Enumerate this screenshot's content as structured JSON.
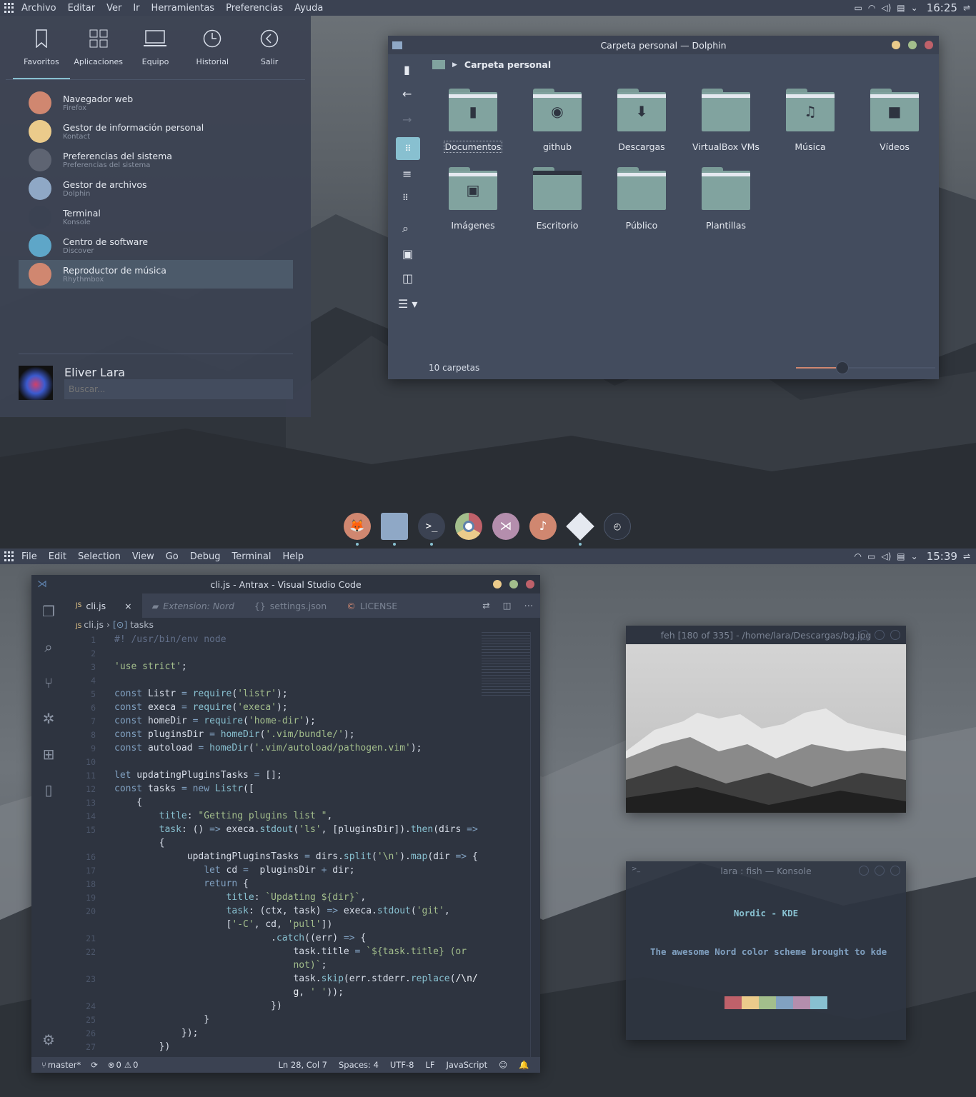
{
  "top": {
    "menu": [
      "Archivo",
      "Editar",
      "Ver",
      "Ir",
      "Herramientas",
      "Preferencias",
      "Ayuda"
    ],
    "clock": "16:25"
  },
  "launcher": {
    "tabs": [
      "Favoritos",
      "Aplicaciones",
      "Equipo",
      "Historial",
      "Salir"
    ],
    "items": [
      {
        "title": "Navegador web",
        "sub": "Firefox",
        "icon": "firefox-icon",
        "color": "#d08770"
      },
      {
        "title": "Gestor de información personal",
        "sub": "Kontact",
        "icon": "kontact-icon",
        "color": "#ebcb8b"
      },
      {
        "title": "Preferencias del sistema",
        "sub": "Preferencias del sistema",
        "icon": "settings-icon",
        "color": "#5e6472"
      },
      {
        "title": "Gestor de archivos",
        "sub": "Dolphin",
        "icon": "folder-icon",
        "color": "#8fa8c6"
      },
      {
        "title": "Terminal",
        "sub": "Konsole",
        "icon": "terminal-icon",
        "color": "#3b4252"
      },
      {
        "title": "Centro de software",
        "sub": "Discover",
        "icon": "discover-icon",
        "color": "#5ea6c8"
      },
      {
        "title": "Reproductor de música",
        "sub": "Rhythmbox",
        "icon": "music-icon",
        "color": "#d08770"
      }
    ],
    "user": "Eliver Lara",
    "search_placeholder": "Buscar..."
  },
  "dolphin": {
    "title": "Carpeta personal — Dolphin",
    "location": "Carpeta personal",
    "folders": [
      {
        "name": "Documentos",
        "glyph": "▮"
      },
      {
        "name": "github",
        "glyph": "◉"
      },
      {
        "name": "Descargas",
        "glyph": "⬇"
      },
      {
        "name": "VirtualBox VMs",
        "glyph": ""
      },
      {
        "name": "Música",
        "glyph": "♫"
      },
      {
        "name": "Vídeos",
        "glyph": "■"
      },
      {
        "name": "Imágenes",
        "glyph": "▣"
      },
      {
        "name": "Escritorio",
        "glyph": ""
      },
      {
        "name": "Público",
        "glyph": ""
      },
      {
        "name": "Plantillas",
        "glyph": ""
      }
    ],
    "status": "10 carpetas"
  },
  "bottom": {
    "menu": [
      "File",
      "Edit",
      "Selection",
      "View",
      "Go",
      "Debug",
      "Terminal",
      "Help"
    ],
    "clock": "15:39"
  },
  "vscode": {
    "title": "cli.js - Antrax - Visual Studio Code",
    "tabs": [
      "cli.js",
      "Extension: Nord",
      "settings.json",
      "LICENSE"
    ],
    "crumb_file": "cli.js",
    "crumb_symbol": "tasks",
    "status": {
      "branch": "master*",
      "errors": "0",
      "warnings": "0",
      "position": "Ln 28, Col 7",
      "spaces": "Spaces: 4",
      "encoding": "UTF-8",
      "eol": "LF",
      "language": "JavaScript"
    },
    "line_numbers": [
      "1",
      "2",
      "3",
      "4",
      "5",
      "6",
      "7",
      "8",
      "9",
      "10",
      "11",
      "12",
      "13",
      "14",
      "15",
      "16",
      "17",
      "18",
      "19",
      "20",
      "21",
      "22",
      "23",
      "24",
      "25",
      "26",
      "27"
    ]
  },
  "feh": {
    "title": "feh [180 of 335] - /home/lara/Descargas/bg.jpg"
  },
  "konsole": {
    "title": "lara : fish — Konsole",
    "heading": "Nordic - KDE",
    "tagline": "The awesome Nord color scheme brought to kde",
    "palette": [
      "#bf616a",
      "#ebcb8b",
      "#a3be8c",
      "#81a1c1",
      "#b48ead",
      "#88c0d0"
    ]
  }
}
